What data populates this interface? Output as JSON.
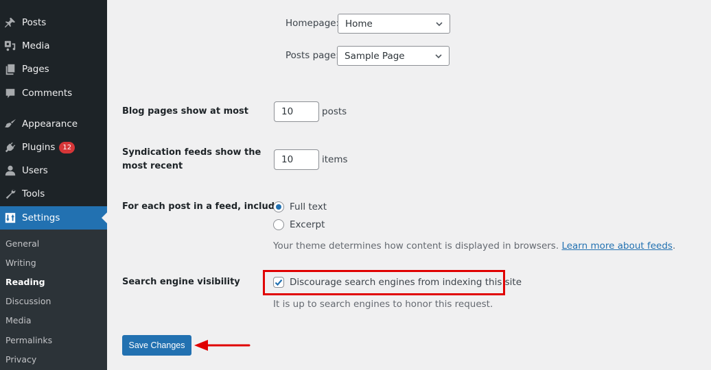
{
  "sidebar": {
    "menu": [
      {
        "label": "Posts",
        "icon": "pushpin-icon"
      },
      {
        "label": "Media",
        "icon": "media-icon"
      },
      {
        "label": "Pages",
        "icon": "pages-icon"
      },
      {
        "label": "Comments",
        "icon": "comment-icon"
      },
      {
        "label": "Appearance",
        "icon": "paintbrush-icon"
      },
      {
        "label": "Plugins",
        "icon": "plugin-icon",
        "badge": "12"
      },
      {
        "label": "Users",
        "icon": "user-icon"
      },
      {
        "label": "Tools",
        "icon": "wrench-icon"
      },
      {
        "label": "Settings",
        "icon": "settings-sliders-icon",
        "current": true
      }
    ],
    "submenu": [
      {
        "label": "General"
      },
      {
        "label": "Writing"
      },
      {
        "label": "Reading",
        "current": true
      },
      {
        "label": "Discussion"
      },
      {
        "label": "Media"
      },
      {
        "label": "Permalinks"
      },
      {
        "label": "Privacy"
      }
    ]
  },
  "reading": {
    "homepage": {
      "label": "Homepage:",
      "value": "Home"
    },
    "posts_page": {
      "label": "Posts page:",
      "value": "Sample Page"
    },
    "blog_pages": {
      "label": "Blog pages show at most",
      "value": "10",
      "unit": "posts"
    },
    "syndication": {
      "label_line1": "Syndication feeds show the",
      "label_line2": "most recent",
      "value": "10",
      "unit": "items"
    },
    "feed_include": {
      "label": "For each post in a feed, include",
      "options": [
        {
          "label": "Full text",
          "checked": true
        },
        {
          "label": "Excerpt",
          "checked": false
        }
      ],
      "description": "Your theme determines how content is displayed in browsers.",
      "link": "Learn more about feeds",
      "link_suffix": "."
    },
    "search_visibility": {
      "label": "Search engine visibility",
      "checkbox_label": "Discourage search engines from indexing this site",
      "checked": true,
      "description": "It is up to search engines to honor this request."
    },
    "save_label": "Save Changes"
  },
  "annotations": {
    "highlight_color": "#e00000",
    "arrow_color": "#e00000"
  }
}
